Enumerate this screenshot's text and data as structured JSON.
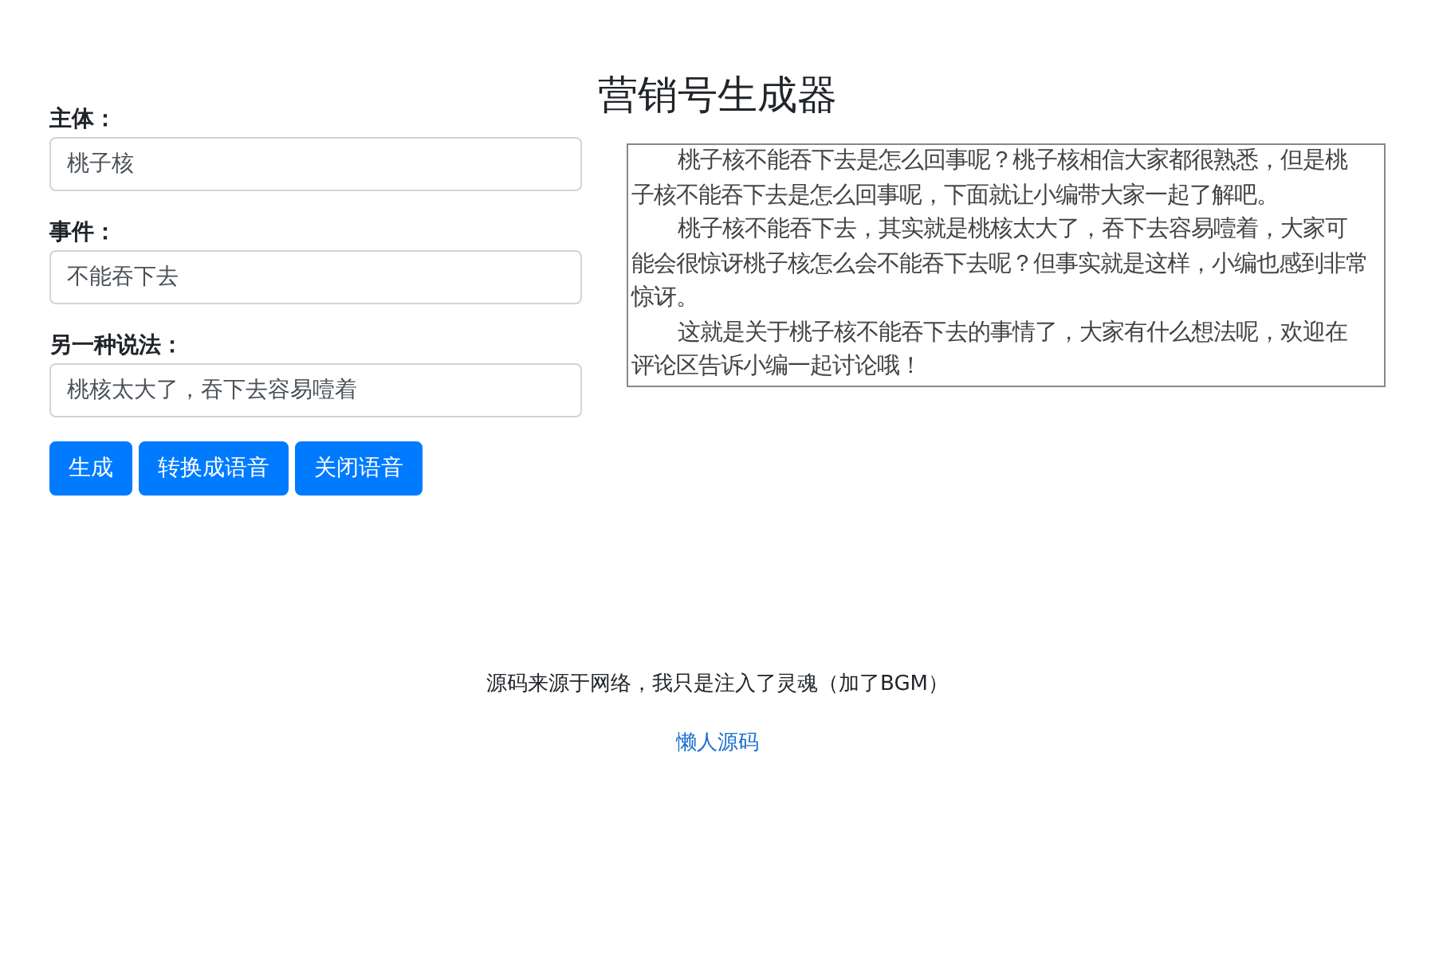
{
  "title": "营销号生成器",
  "fields": [
    {
      "label": "主体：",
      "value": "桃子核"
    },
    {
      "label": "事件：",
      "value": "不能吞下去"
    },
    {
      "label": "另一种说法：",
      "value": "桃核太大了，吞下去容易噎着"
    }
  ],
  "buttons": [
    "生成",
    "转换成语音",
    "关闭语音"
  ],
  "output": [
    "桃子核不能吞下去是怎么回事呢？桃子核相信大家都很熟悉，但是桃子核不能吞下去是怎么回事呢，下面就让小编带大家一起了解吧。",
    "桃子核不能吞下去，其实就是桃核太大了，吞下去容易噎着，大家可能会很惊讶桃子核怎么会不能吞下去呢？但事实就是这样，小编也感到非常惊讶。",
    "这就是关于桃子核不能吞下去的事情了，大家有什么想法呢，欢迎在评论区告诉小编一起讨论哦！"
  ],
  "footer": {
    "note": "源码来源于网络，我只是注入了灵魂（加了BGM）",
    "link": "懒人源码"
  }
}
